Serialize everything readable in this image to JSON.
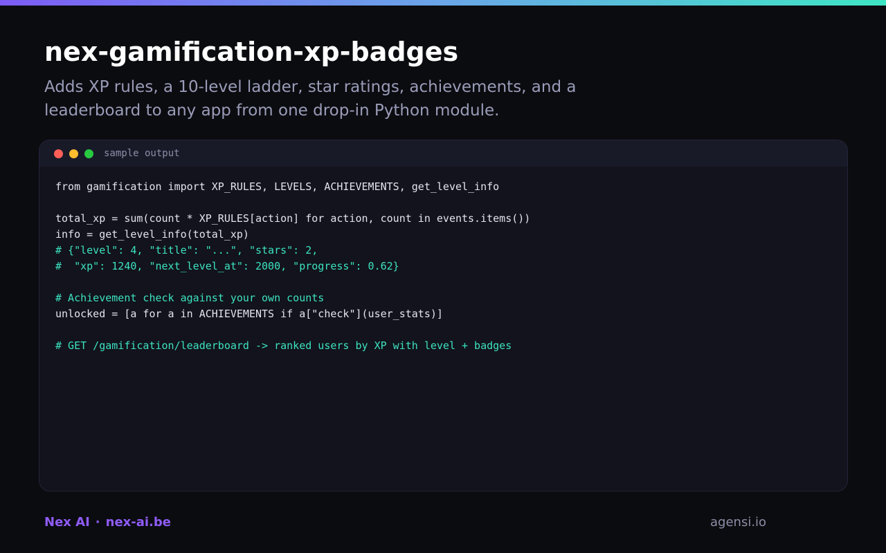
{
  "header": {
    "title": "nex-gamification-xp-badges",
    "subtitle": "Adds XP rules, a 10-level ladder, star ratings, achievements, and a leaderboard to any app from one drop-in Python module."
  },
  "terminal": {
    "title": "sample output",
    "lines": [
      {
        "text": "from gamification import XP_RULES, LEVELS, ACHIEVEMENTS, get_level_info",
        "kind": "plain"
      },
      {
        "text": "",
        "kind": "plain"
      },
      {
        "text": "total_xp = sum(count * XP_RULES[action] for action, count in events.items())",
        "kind": "plain"
      },
      {
        "text": "info = get_level_info(total_xp)",
        "kind": "plain"
      },
      {
        "text": "# {\"level\": 4, \"title\": \"...\", \"stars\": 2,",
        "kind": "comment"
      },
      {
        "text": "#  \"xp\": 1240, \"next_level_at\": 2000, \"progress\": 0.62}",
        "kind": "comment"
      },
      {
        "text": "",
        "kind": "plain"
      },
      {
        "text": "# Achievement check against your own counts",
        "kind": "comment"
      },
      {
        "text": "unlocked = [a for a in ACHIEVEMENTS if a[\"check\"](user_stats)]",
        "kind": "plain"
      },
      {
        "text": "",
        "kind": "plain"
      },
      {
        "text": "# GET /gamification/leaderboard -> ranked users by XP with level + badges",
        "kind": "comment"
      }
    ]
  },
  "footer": {
    "brand": "Nex AI",
    "separator": "·",
    "site": "nex-ai.be",
    "credit": "agensi.io"
  },
  "colors": {
    "accent": "#8f5cf6",
    "comment": "#3de2c0",
    "code_text": "#e3e4ee",
    "background": "#0b0c10"
  }
}
